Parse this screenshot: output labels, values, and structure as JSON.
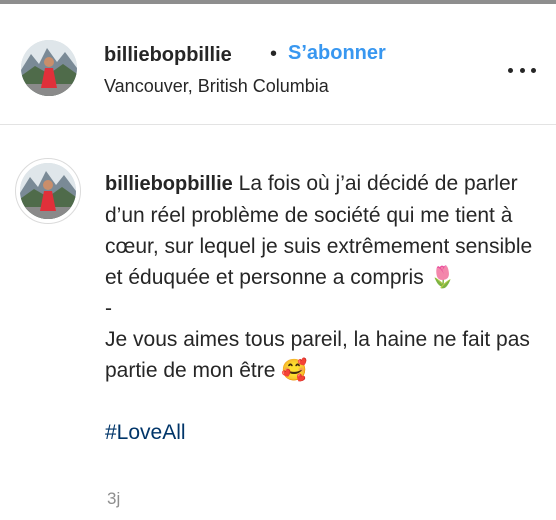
{
  "post_header": {
    "username": "billiebopbillie",
    "separator": "•",
    "follow_label": "S’abonner",
    "location": "Vancouver, British Columbia",
    "more_icon": "more-horizontal-icon"
  },
  "comment": {
    "username": "billiebopbillie",
    "line1": "La fois où j’ai décidé de parler d’un réel problème de société qui me tient à cœur, sur lequel je suis extrêmement sensible et éduquée et personne a compris",
    "tulip_emoji": "🌷",
    "dash": "-",
    "line2": "Je vous aimes tous pareil, la haine ne fait pas partie de mon être",
    "smile_emoji": "🥰",
    "hashtag": "#LoveAll",
    "timestamp": "3j"
  },
  "colors": {
    "accent": "#3897f0",
    "hashtag": "#003569",
    "muted": "#8e8e8e",
    "text": "#262626"
  }
}
